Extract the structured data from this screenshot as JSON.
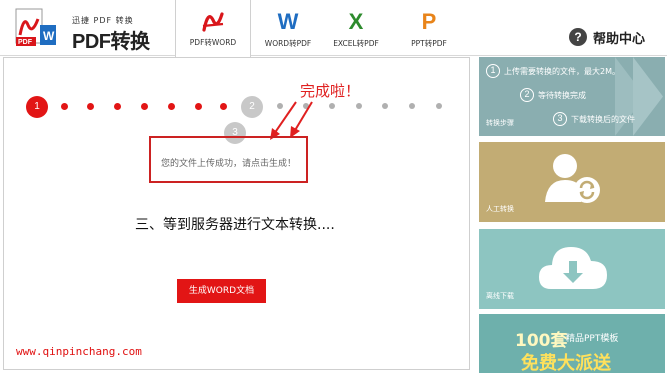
{
  "header": {
    "logo_small": "迅捷 PDF 转换",
    "logo_big": "PDF转换器",
    "logo_icon_pdf": "PDF",
    "logo_icon_word": "W",
    "tabs": [
      {
        "icon": "⌒",
        "label": "PDF转WORD",
        "color": "#d9161b"
      },
      {
        "icon": "W",
        "label": "WORD转PDF",
        "color": "#1f6dc1"
      },
      {
        "icon": "X",
        "label": "EXCEL转PDF",
        "color": "#2d8b2d"
      },
      {
        "icon": "P",
        "label": "PPT转PDF",
        "color": "#e8841a"
      }
    ],
    "help_icon": "?",
    "help_label": "帮助中心"
  },
  "main": {
    "step_current": "1",
    "step_2": "2",
    "step_3": "3",
    "annotation": "完成啦！",
    "message": "您的文件上传成功，请点击生成！",
    "stage_text": "三、等到服务器进行文本转换....",
    "generate_button": "生成WORD文档",
    "site_url": "www.qinpinchang.com"
  },
  "sidebar": {
    "steps_panel": {
      "title": "转换步骤",
      "steps": [
        {
          "n": "1",
          "text": "上传需要转换的文件，最大2M。"
        },
        {
          "n": "2",
          "text": "等待转换完成"
        },
        {
          "n": "3",
          "text": "下载转换后的文件"
        }
      ]
    },
    "manual_panel": {
      "title": "人工转换"
    },
    "offline_panel": {
      "title": "离线下载"
    },
    "ad_panel": {
      "headline_num": "100套",
      "headline_text": "精品PPT模板",
      "tagline": "免费大派送"
    }
  },
  "colors": {
    "accent_red": "#e21515",
    "step_inactive": "#c8c8c8",
    "dot_active": "#e21515",
    "dot_inactive": "#b0b0b0"
  }
}
